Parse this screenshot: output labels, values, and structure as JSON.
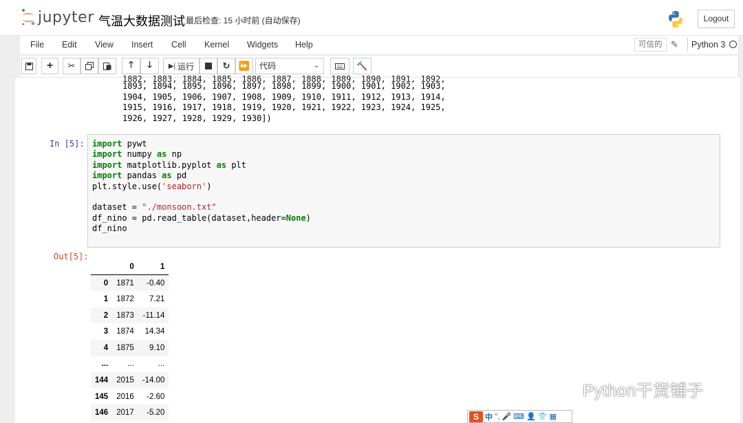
{
  "header": {
    "logo_text": "jupyter",
    "notebook_name": "气温大数据测试",
    "checkpoint_text": "最后检查: 15 小时前  (自动保存)",
    "logout_label": "Logout"
  },
  "menubar": {
    "items": [
      "File",
      "Edit",
      "View",
      "Insert",
      "Cell",
      "Kernel",
      "Widgets",
      "Help"
    ],
    "trusted_label": "可信的",
    "kernel_name": "Python 3"
  },
  "toolbar": {
    "run_label": "运行",
    "cell_type": "代码"
  },
  "prev_output_lines": [
    "1893, 1894, 1895, 1896, 1897, 1898, 1899, 1900, 1901, 1902, 1903,",
    "1904, 1905, 1906, 1907, 1908, 1909, 1910, 1911, 1912, 1913, 1914,",
    "1915, 1916, 1917, 1918, 1919, 1920, 1921, 1922, 1923, 1924, 1925,",
    "1926, 1927, 1928, 1929, 1930])"
  ],
  "cell": {
    "in_prompt": "In  [5]:",
    "out_prompt": "Out[5]:"
  },
  "code": {
    "l1_kw": "import",
    "l1_rest": " pywt",
    "l2_kw": "import",
    "l2_a": " numpy ",
    "l2_kw2": "as",
    "l2_b": " np",
    "l3_kw": "import",
    "l3_a": " matplotlib.pyplot ",
    "l3_kw2": "as",
    "l3_b": " plt",
    "l4_kw": "import",
    "l4_a": " pandas ",
    "l4_kw2": "as",
    "l4_b": " pd",
    "l5_a": "plt.style.use(",
    "l5_str": "'seaborn'",
    "l5_b": ")",
    "l7_a": "dataset = ",
    "l7_str": "\"./monsoon.txt\"",
    "l8_a": "df_nino = pd.read_table(dataset,header=",
    "l8_kw": "None",
    "l8_b": ")",
    "l9": "df_nino"
  },
  "dataframe": {
    "columns": [
      "",
      "0",
      "1"
    ],
    "rows": [
      [
        "0",
        "1871",
        "-0.40"
      ],
      [
        "1",
        "1872",
        "7.21"
      ],
      [
        "2",
        "1873",
        "-11.14"
      ],
      [
        "3",
        "1874",
        "14.34"
      ],
      [
        "4",
        "1875",
        "9.10"
      ],
      [
        "...",
        "...",
        "..."
      ],
      [
        "144",
        "2015",
        "-14.00"
      ],
      [
        "145",
        "2016",
        "-2.60"
      ],
      [
        "146",
        "2017",
        "-5.20"
      ]
    ]
  },
  "watermark": {
    "text": "Python干货铺子"
  },
  "ime": {
    "items": [
      "中",
      "°,"
    ]
  },
  "colors": {
    "in_prompt": "#303f9f",
    "out_prompt": "#d84315",
    "keyword": "#008000",
    "string": "#ba2121"
  }
}
